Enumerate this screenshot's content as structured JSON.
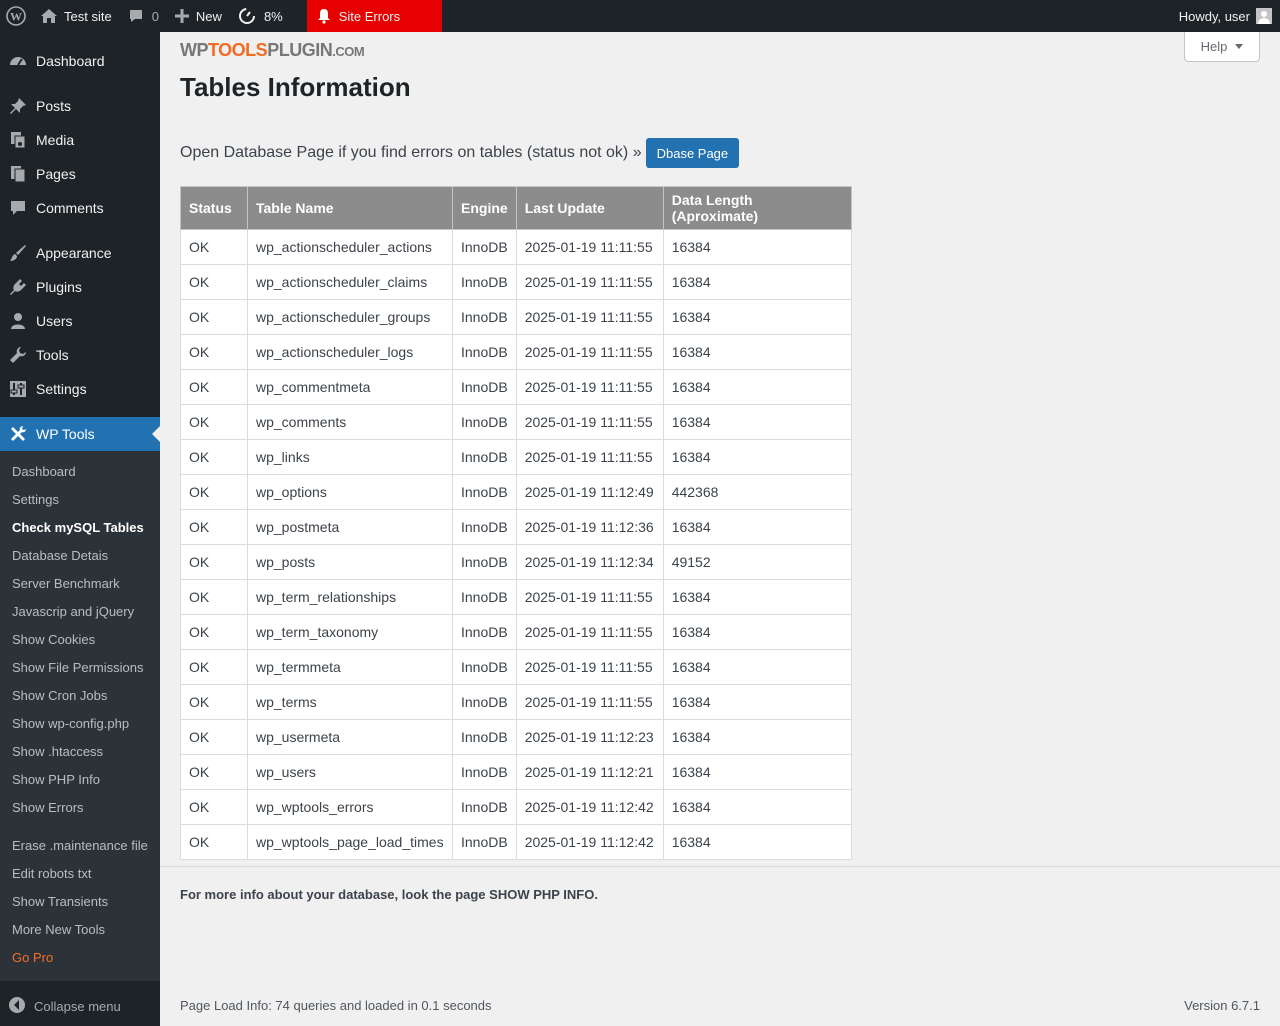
{
  "adminbar": {
    "site_name": "Test site",
    "comments_count": "0",
    "new_label": "New",
    "performance": "8%",
    "site_errors": "Site Errors",
    "howdy": "Howdy, user"
  },
  "sidebar": {
    "items": [
      {
        "label": "Dashboard"
      },
      {
        "label": "Posts"
      },
      {
        "label": "Media"
      },
      {
        "label": "Pages"
      },
      {
        "label": "Comments"
      },
      {
        "label": "Appearance"
      },
      {
        "label": "Plugins"
      },
      {
        "label": "Users"
      },
      {
        "label": "Tools"
      },
      {
        "label": "Settings"
      },
      {
        "label": "WP Tools"
      }
    ],
    "submenu": [
      "Dashboard",
      "Settings",
      "Check mySQL Tables",
      "Database Detais",
      "Server Benchmark",
      "Javascrip and jQuery",
      "Show Cookies",
      "Show File Permissions",
      "Show Cron Jobs",
      "Show wp-config.php",
      "Show .htaccess",
      "Show PHP Info",
      "Show Errors",
      "Erase .maintenance file",
      "Edit robots txt",
      "Show Transients",
      "More New Tools",
      "Go Pro"
    ],
    "collapse_label": "Collapse menu"
  },
  "header": {
    "logo_wp": "WP",
    "logo_tools": "TOOLS",
    "logo_plugin": "PLUGIN",
    "logo_com": ".COM",
    "help_label": "Help",
    "title": "Tables Information"
  },
  "intro": {
    "text": "Open Database Page if you find errors on tables (status not ok) »",
    "button_label": "Dbase Page"
  },
  "table": {
    "columns": [
      "Status",
      "Table Name",
      "Engine",
      "Last Update",
      "Data Length (Aproximate)"
    ],
    "rows": [
      [
        "OK",
        "wp_actionscheduler_actions",
        "InnoDB",
        "2025-01-19 11:11:55",
        "16384"
      ],
      [
        "OK",
        "wp_actionscheduler_claims",
        "InnoDB",
        "2025-01-19 11:11:55",
        "16384"
      ],
      [
        "OK",
        "wp_actionscheduler_groups",
        "InnoDB",
        "2025-01-19 11:11:55",
        "16384"
      ],
      [
        "OK",
        "wp_actionscheduler_logs",
        "InnoDB",
        "2025-01-19 11:11:55",
        "16384"
      ],
      [
        "OK",
        "wp_commentmeta",
        "InnoDB",
        "2025-01-19 11:11:55",
        "16384"
      ],
      [
        "OK",
        "wp_comments",
        "InnoDB",
        "2025-01-19 11:11:55",
        "16384"
      ],
      [
        "OK",
        "wp_links",
        "InnoDB",
        "2025-01-19 11:11:55",
        "16384"
      ],
      [
        "OK",
        "wp_options",
        "InnoDB",
        "2025-01-19 11:12:49",
        "442368"
      ],
      [
        "OK",
        "wp_postmeta",
        "InnoDB",
        "2025-01-19 11:12:36",
        "16384"
      ],
      [
        "OK",
        "wp_posts",
        "InnoDB",
        "2025-01-19 11:12:34",
        "49152"
      ],
      [
        "OK",
        "wp_term_relationships",
        "InnoDB",
        "2025-01-19 11:11:55",
        "16384"
      ],
      [
        "OK",
        "wp_term_taxonomy",
        "InnoDB",
        "2025-01-19 11:11:55",
        "16384"
      ],
      [
        "OK",
        "wp_termmeta",
        "InnoDB",
        "2025-01-19 11:11:55",
        "16384"
      ],
      [
        "OK",
        "wp_terms",
        "InnoDB",
        "2025-01-19 11:11:55",
        "16384"
      ],
      [
        "OK",
        "wp_usermeta",
        "InnoDB",
        "2025-01-19 11:12:23",
        "16384"
      ],
      [
        "OK",
        "wp_users",
        "InnoDB",
        "2025-01-19 11:12:21",
        "16384"
      ],
      [
        "OK",
        "wp_wptools_errors",
        "InnoDB",
        "2025-01-19 11:12:42",
        "16384"
      ],
      [
        "OK",
        "wp_wptools_page_load_times",
        "InnoDB",
        "2025-01-19 11:12:42",
        "16384"
      ]
    ]
  },
  "more_info": "For more info about your database, look the page SHOW PHP INFO.",
  "footer": {
    "load_info": "Page Load Info: 74 queries and loaded in 0.1 seconds",
    "version": "Version 6.7.1"
  }
}
